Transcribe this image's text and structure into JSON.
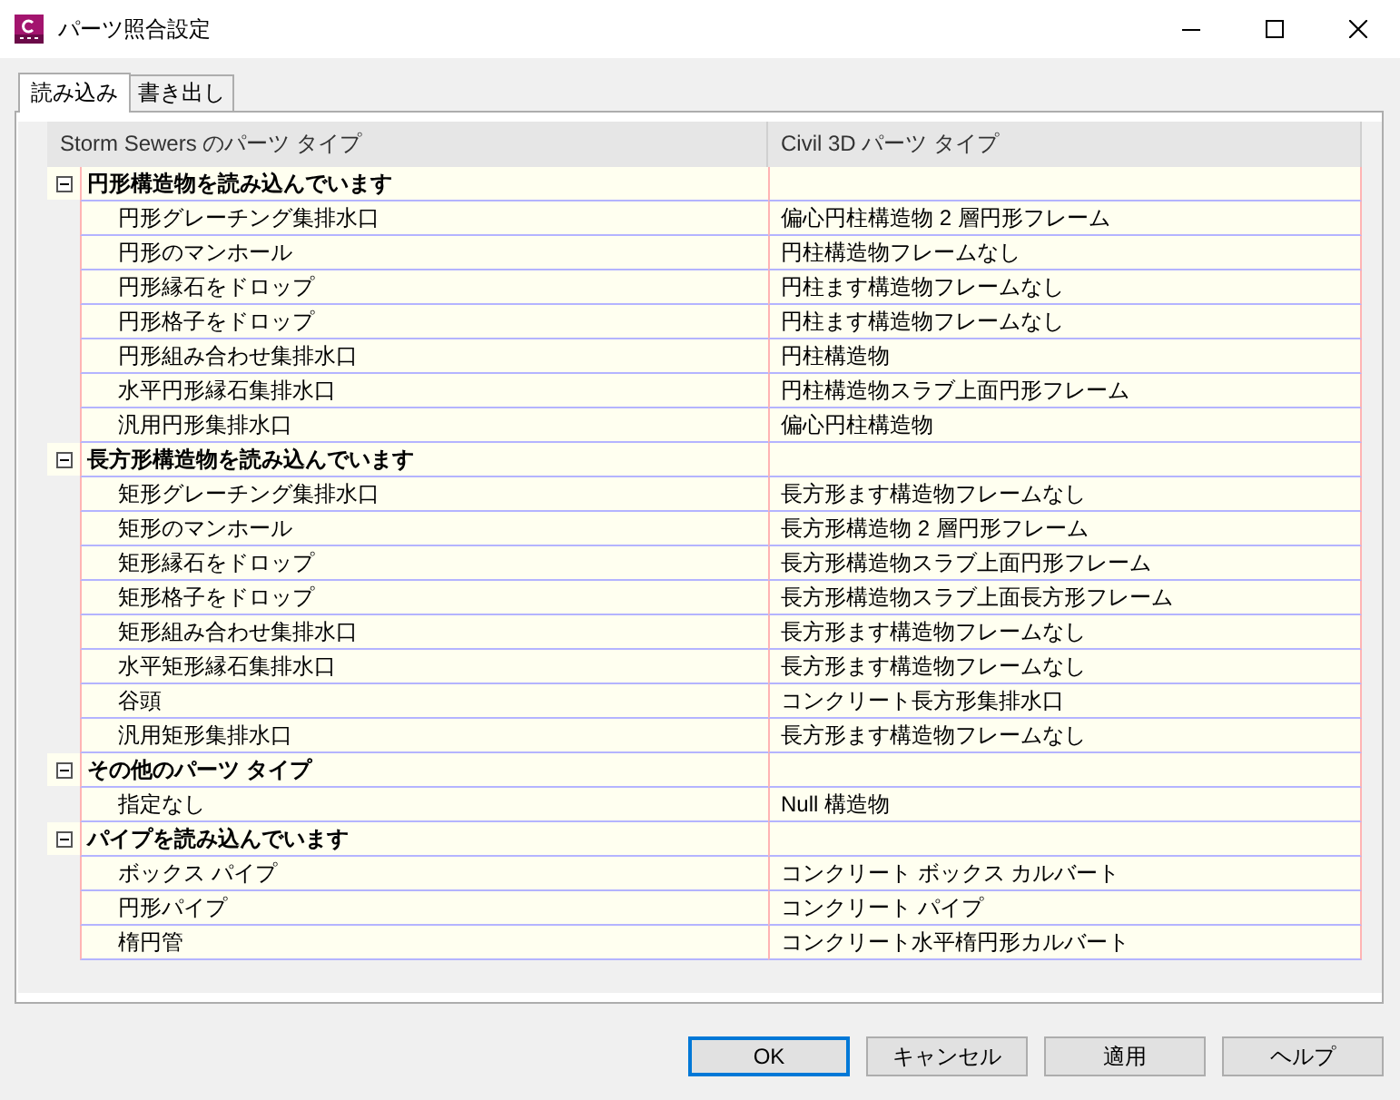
{
  "window": {
    "title": "パーツ照合設定"
  },
  "tabs": [
    {
      "label": "読み込み",
      "selected": true
    },
    {
      "label": "書き出し",
      "selected": false
    }
  ],
  "table": {
    "columns": [
      "Storm Sewers のパーツ タイプ",
      "Civil 3D パーツ タイプ"
    ],
    "groups": [
      {
        "label": "円形構造物を読み込んでいます",
        "expanded": true,
        "children": [
          {
            "part_type": "円形グレーチング集排水口",
            "civil3d_type": "偏心円柱構造物 2 層円形フレーム"
          },
          {
            "part_type": "円形のマンホール",
            "civil3d_type": "円柱構造物フレームなし"
          },
          {
            "part_type": "円形縁石をドロップ",
            "civil3d_type": "円柱ます構造物フレームなし"
          },
          {
            "part_type": "円形格子をドロップ",
            "civil3d_type": "円柱ます構造物フレームなし"
          },
          {
            "part_type": "円形組み合わせ集排水口",
            "civil3d_type": "円柱構造物"
          },
          {
            "part_type": "水平円形縁石集排水口",
            "civil3d_type": "円柱構造物スラブ上面円形フレーム"
          },
          {
            "part_type": "汎用円形集排水口",
            "civil3d_type": "偏心円柱構造物"
          }
        ]
      },
      {
        "label": "長方形構造物を読み込んでいます",
        "expanded": true,
        "children": [
          {
            "part_type": "矩形グレーチング集排水口",
            "civil3d_type": "長方形ます構造物フレームなし"
          },
          {
            "part_type": "矩形のマンホール",
            "civil3d_type": "長方形構造物 2 層円形フレーム"
          },
          {
            "part_type": "矩形縁石をドロップ",
            "civil3d_type": "長方形構造物スラブ上面円形フレーム"
          },
          {
            "part_type": "矩形格子をドロップ",
            "civil3d_type": "長方形構造物スラブ上面長方形フレーム"
          },
          {
            "part_type": "矩形組み合わせ集排水口",
            "civil3d_type": "長方形ます構造物フレームなし"
          },
          {
            "part_type": "水平矩形縁石集排水口",
            "civil3d_type": "長方形ます構造物フレームなし"
          },
          {
            "part_type": "谷頭",
            "civil3d_type": "コンクリート長方形集排水口"
          },
          {
            "part_type": "汎用矩形集排水口",
            "civil3d_type": "長方形ます構造物フレームなし"
          }
        ]
      },
      {
        "label": "その他のパーツ タイプ",
        "expanded": true,
        "children": [
          {
            "part_type": "指定なし",
            "civil3d_type": "Null 構造物"
          }
        ]
      },
      {
        "label": "パイプを読み込んでいます",
        "expanded": true,
        "children": [
          {
            "part_type": "ボックス パイプ",
            "civil3d_type": "コンクリート ボックス カルバート"
          },
          {
            "part_type": "円形パイプ",
            "civil3d_type": "コンクリート パイプ"
          },
          {
            "part_type": "楕円管",
            "civil3d_type": "コンクリート水平楕円形カルバート"
          }
        ]
      }
    ]
  },
  "buttons": [
    {
      "label": "OK",
      "default": true
    },
    {
      "label": "キャンセル",
      "default": false
    },
    {
      "label": "適用",
      "default": false
    },
    {
      "label": "ヘルプ",
      "default": false
    }
  ]
}
